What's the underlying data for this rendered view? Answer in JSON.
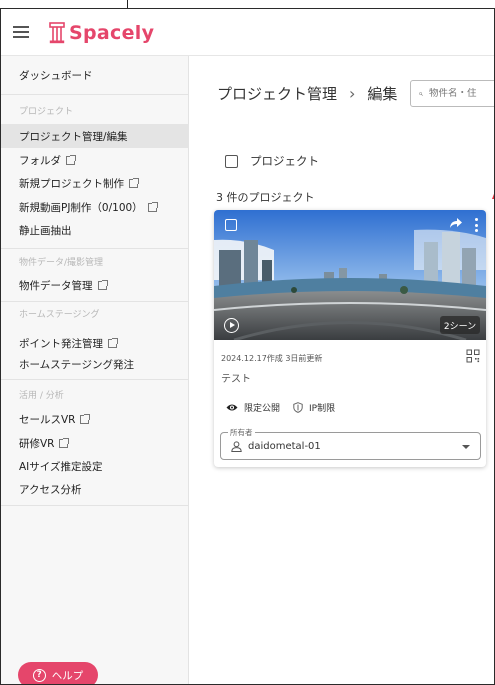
{
  "app": {
    "brand": "Spacely",
    "brand_color": "#e5466b"
  },
  "sidebar": {
    "items": [
      {
        "label": "ダッシュボード",
        "external": false
      },
      {
        "label": "プロジェクト管理/編集",
        "external": false,
        "active": true
      },
      {
        "label": "フォルダ",
        "external": true
      },
      {
        "label": "新規プロジェクト制作",
        "external": true
      },
      {
        "label": "新規動画PJ制作（0/100）",
        "external": true
      },
      {
        "label": "静止画抽出",
        "external": false
      },
      {
        "label": "物件データ管理",
        "external": true
      },
      {
        "label": "ポイント発注管理",
        "external": true
      },
      {
        "label": "ホームステージング発注",
        "external": false
      },
      {
        "label": "セールスVR",
        "external": true
      },
      {
        "label": "研修VR",
        "external": true
      },
      {
        "label": "AIサイズ推定設定",
        "external": false
      },
      {
        "label": "アクセス分析",
        "external": false
      }
    ],
    "sections": {
      "project": "プロジェクト",
      "property": "物件データ/撮影管理",
      "staging": "ホームステージング",
      "usage": "活用 / 分析"
    },
    "help_label": "ヘルプ"
  },
  "main": {
    "breadcrumb": {
      "root": "プロジェクト管理",
      "separator": "›",
      "current": "編集"
    },
    "search": {
      "placeholder": "物件名・住"
    },
    "select_all_label": "プロジェクト",
    "count_label": "3 件のプロジェクト",
    "card": {
      "scenes_label": "2シーン",
      "date_text": "2024.12.17作成 3日前更新",
      "title": "テスト",
      "visibility_label": "限定公開",
      "ip_label": "IP制限",
      "owner_label": "所有者",
      "owner_value": "daidometal-01"
    }
  }
}
